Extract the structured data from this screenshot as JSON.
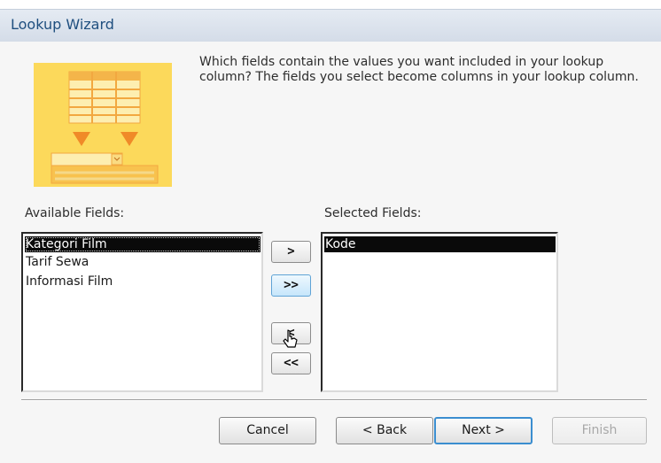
{
  "window": {
    "title": "Lookup Wizard"
  },
  "instruction": "Which fields contain the values you want included in your lookup column? The fields you select become columns in your lookup column.",
  "available": {
    "label": "Available Fields:",
    "items": [
      "Kategori Film",
      "Tarif Sewa",
      "Informasi Film"
    ],
    "selected_index": 0
  },
  "selected": {
    "label": "Selected Fields:",
    "items": [
      "Kode"
    ],
    "selected_index": 0
  },
  "move_buttons": {
    "add": ">",
    "add_all": ">>",
    "remove": "<",
    "remove_all": "<<"
  },
  "footer": {
    "cancel": "Cancel",
    "back": "< Back",
    "next": "Next >",
    "finish": "Finish"
  },
  "icons": {
    "wizard_art": "lookup-table-illustration-icon",
    "cursor": "mouse-pointer-icon"
  },
  "colors": {
    "titlebar": "#dbe3ee",
    "title_text": "#1f4f7f",
    "art_background": "#fcd95b",
    "selection": "#0a0a0a",
    "focus_border": "#3b8ed0"
  }
}
